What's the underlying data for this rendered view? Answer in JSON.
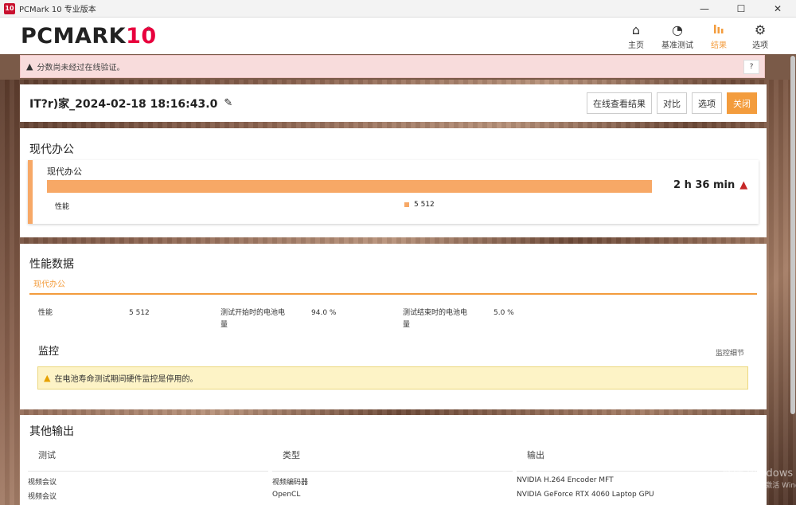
{
  "window": {
    "title": "PCMark 10 专业版本",
    "app_icon": "10",
    "controls": [
      "—",
      "☐",
      "✕"
    ]
  },
  "header": {
    "logo_main": "PCMARK",
    "logo_num": "10",
    "logo_reg": "®",
    "nav": [
      {
        "label": "主页",
        "icon": "home-icon",
        "glyph": "⌂"
      },
      {
        "label": "基准测试",
        "icon": "gauge-icon",
        "glyph": "◔"
      },
      {
        "label": "结果",
        "icon": "bar-chart-icon",
        "glyph": "▮▮▮"
      },
      {
        "label": "选项",
        "icon": "gear-icon",
        "glyph": "⚙"
      }
    ],
    "active": "结果"
  },
  "alert_top": {
    "text": "分数尚未经过在线验证。",
    "help": "?"
  },
  "result": {
    "title": "IT?r)家_2024-02-18 18:16:43.0",
    "buttons": {
      "view_online": "在线查看结果",
      "compare": "对比",
      "options": "选项",
      "close": "关闭"
    }
  },
  "section_modern_office": {
    "title": "现代办公",
    "card_title": "现代办公",
    "duration": "2 h 36 min",
    "perf_label": "性能",
    "legend_value": "5 512"
  },
  "perf_data": {
    "title": "性能数据",
    "tab": "现代办公",
    "stats": {
      "perf_label": "性能",
      "perf_value": "5 512",
      "start_batt_label_1": "测试开始时的电池电",
      "start_batt_label_2": "量",
      "start_batt_value": "94.0 %",
      "end_batt_label_1": "测试结束时的电池电",
      "end_batt_label_2": "量",
      "end_batt_value": "5.0 %"
    },
    "monitor_title": "监控",
    "monitor_detail": "监控细节",
    "monitor_alert": "在电池寿命测试期间硬件监控是停用的。"
  },
  "other_output": {
    "title": "其他输出",
    "columns": [
      "测试",
      "类型",
      "输出"
    ],
    "rows": [
      [
        "视频会议",
        "视频编码器",
        "NVIDIA H.264 Encoder MFT"
      ],
      [
        "视频会议",
        "OpenCL",
        "NVIDIA GeForce RTX 4060 Laptop GPU"
      ]
    ]
  },
  "watermark": {
    "line1": "激活 Windows",
    "line2": "转到\"设置\"以激活 Windows"
  },
  "colors": {
    "accent": "#f39c3d",
    "bar": "#f7a866",
    "logo_red": "#e8003d"
  }
}
